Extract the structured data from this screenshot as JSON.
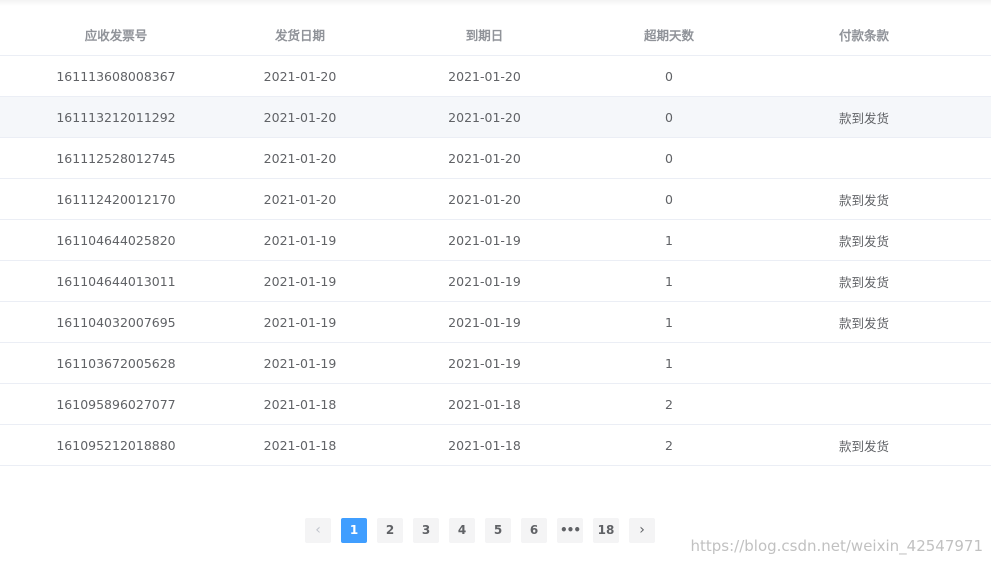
{
  "table": {
    "columns": [
      "应收发票号",
      "发货日期",
      "到期日",
      "超期天数",
      "付款条款"
    ],
    "rows": [
      [
        "161113608008367",
        "2021-01-20",
        "2021-01-20",
        "0",
        ""
      ],
      [
        "161113212011292",
        "2021-01-20",
        "2021-01-20",
        "0",
        "款到发货"
      ],
      [
        "161112528012745",
        "2021-01-20",
        "2021-01-20",
        "0",
        ""
      ],
      [
        "161112420012170",
        "2021-01-20",
        "2021-01-20",
        "0",
        "款到发货"
      ],
      [
        "161104644025820",
        "2021-01-19",
        "2021-01-19",
        "1",
        "款到发货"
      ],
      [
        "161104644013011",
        "2021-01-19",
        "2021-01-19",
        "1",
        "款到发货"
      ],
      [
        "161104032007695",
        "2021-01-19",
        "2021-01-19",
        "1",
        "款到发货"
      ],
      [
        "161103672005628",
        "2021-01-19",
        "2021-01-19",
        "1",
        ""
      ],
      [
        "161095896027077",
        "2021-01-18",
        "2021-01-18",
        "2",
        ""
      ],
      [
        "161095212018880",
        "2021-01-18",
        "2021-01-18",
        "2",
        "款到发货"
      ]
    ],
    "striped_row_color": "#f5f7fa"
  },
  "pagination": {
    "prev_icon": "chevron-left-icon",
    "prev_glyph": "‹",
    "pages": [
      "1",
      "2",
      "3",
      "4",
      "5",
      "6"
    ],
    "current_page": "1",
    "more_glyph": "•••",
    "last_page": "18",
    "next_icon": "chevron-right-icon",
    "next_glyph": "›",
    "accent_color": "#409eff"
  },
  "watermark": "https://blog.csdn.net/weixin_42547971"
}
